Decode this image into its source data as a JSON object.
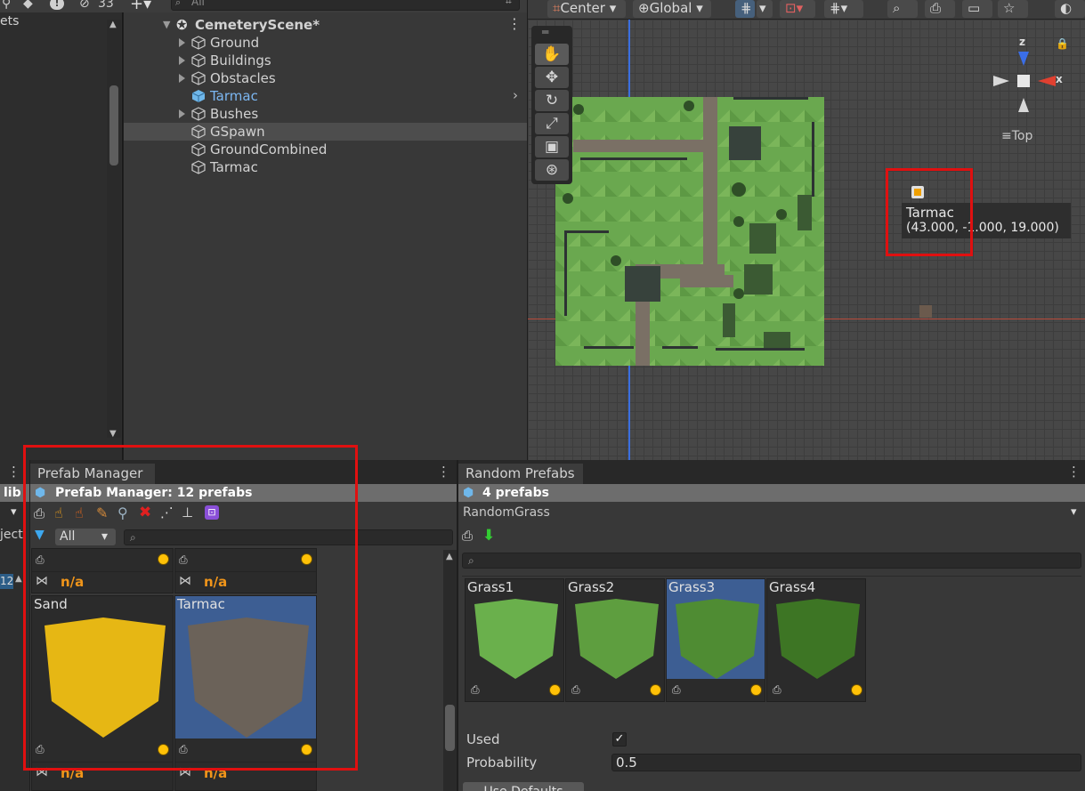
{
  "top": {
    "eye_count": "33",
    "search_placeholder": "All",
    "scene_buttons": {
      "pivot": "Center",
      "space": "Global"
    }
  },
  "project": {
    "label_partial": "ets"
  },
  "hierarchy": {
    "scene_name": "CemeteryScene*",
    "items": [
      {
        "label": "Ground"
      },
      {
        "label": "Buildings"
      },
      {
        "label": "Obstacles"
      },
      {
        "label": "Tarmac"
      },
      {
        "label": "Bushes"
      },
      {
        "label": "GSpawn"
      },
      {
        "label": "GroundCombined"
      },
      {
        "label": "Tarmac"
      }
    ]
  },
  "scene": {
    "gizmo": {
      "view": "Top",
      "z": "z",
      "x": "x"
    },
    "tooltip": {
      "name": "Tarmac",
      "coords": "(43.000, -1.000, 19.000)"
    }
  },
  "left_stub": {
    "tab": "lib",
    "label": "ject",
    "badge": "12"
  },
  "prefab_manager": {
    "tab": "Prefab Manager",
    "header": "Prefab Manager: 12 prefabs",
    "filter": "All",
    "cards": [
      {
        "name": "",
        "link": "n/a"
      },
      {
        "name": "",
        "link": "n/a"
      },
      {
        "name": "Sand",
        "link": "n/a",
        "color": "#e6b714"
      },
      {
        "name": "Tarmac",
        "link": "n/a",
        "color": "#6b6259"
      }
    ]
  },
  "random_prefabs": {
    "tab": "Random Prefabs",
    "header": "4 prefabs",
    "group": "RandomGrass",
    "cards": [
      {
        "name": "Grass1",
        "color": "#6ab04c"
      },
      {
        "name": "Grass2",
        "color": "#5e9e3f"
      },
      {
        "name": "Grass3",
        "color": "#4f8c33"
      },
      {
        "name": "Grass4",
        "color": "#3d7524"
      }
    ],
    "props": {
      "used_label": "Used",
      "used": "✓",
      "probability_label": "Probability",
      "probability": "0.5",
      "defaults_button": "Use Defaults"
    }
  }
}
